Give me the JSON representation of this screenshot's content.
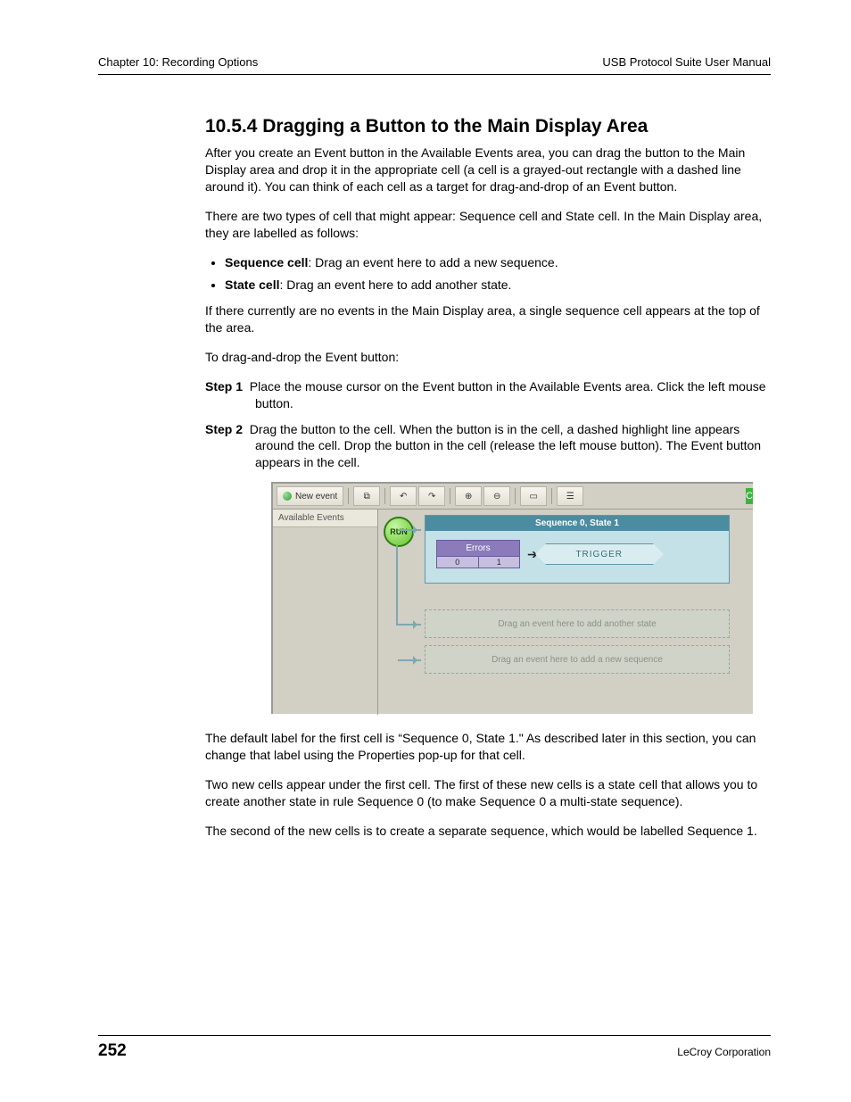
{
  "header": {
    "left": "Chapter 10: Recording Options",
    "right": "USB Protocol Suite User Manual"
  },
  "section": {
    "title": "10.5.4 Dragging a Button to the Main Display Area",
    "p1": "After you create an Event button in the Available Events area, you can drag the button to the Main Display area and drop it in the appropriate cell (a cell is a grayed-out rectangle with a dashed line around it). You can think of each cell as a target for drag-and-drop of an Event button.",
    "p2": "There are two types of cell that might appear: Sequence cell and State cell. In the Main Display area, they are labelled as follows:",
    "bullets": {
      "seq_label": "Sequence cell",
      "seq_text": ": Drag an event here to add a new sequence.",
      "state_label": "State cell",
      "state_text": ": Drag an event here to add another state."
    },
    "p3": "If there currently are no events in the Main Display area, a single sequence cell appears at the top of the area.",
    "p4": "To drag-and-drop the Event button:",
    "steps": {
      "s1_label": "Step 1",
      "s1_text": "Place the mouse cursor on the Event button in the Available Events area. Click the left mouse button.",
      "s2_label": "Step 2",
      "s2_text": "Drag the button to the cell. When the button is in the cell, a dashed highlight line appears around the cell. Drop the button in the cell (release the left mouse button). The Event button appears in the cell."
    },
    "p5": "The default label for the first cell is “Sequence 0, State 1.\" As described later in this section, you can change that label using the Properties pop-up for that cell.",
    "p6": "Two new cells appear under the first cell. The first of these new cells is a state cell that allows you to create another state in rule Sequence 0 (to make Sequence 0 a multi-state sequence).",
    "p7": "The second of the new cells is to create a separate sequence, which would be labelled Sequence 1."
  },
  "figure": {
    "toolbar": {
      "new_event": "New event",
      "icons": [
        "copy-icon",
        "undo-icon",
        "redo-icon",
        "zoom-in-icon",
        "zoom-out-icon",
        "fit-icon",
        "properties-icon"
      ],
      "glyphs": {
        "copy-icon": "⧉",
        "undo-icon": "↶",
        "redo-icon": "↷",
        "zoom-in-icon": "⊕",
        "zoom-out-icon": "⊖",
        "fit-icon": "▭",
        "properties-icon": "☰"
      },
      "corner": "C"
    },
    "available_events": "Available Events",
    "run": "RUN",
    "sequence_header": "Sequence 0, State 1",
    "errors_label": "Errors",
    "errors_foot_0": "0",
    "errors_foot_1": "1",
    "trigger": "TRIGGER",
    "drop_state": "Drag an event here to add another state",
    "drop_sequence": "Drag an event here to add a new sequence"
  },
  "footer": {
    "page": "252",
    "corp": "LeCroy Corporation"
  }
}
